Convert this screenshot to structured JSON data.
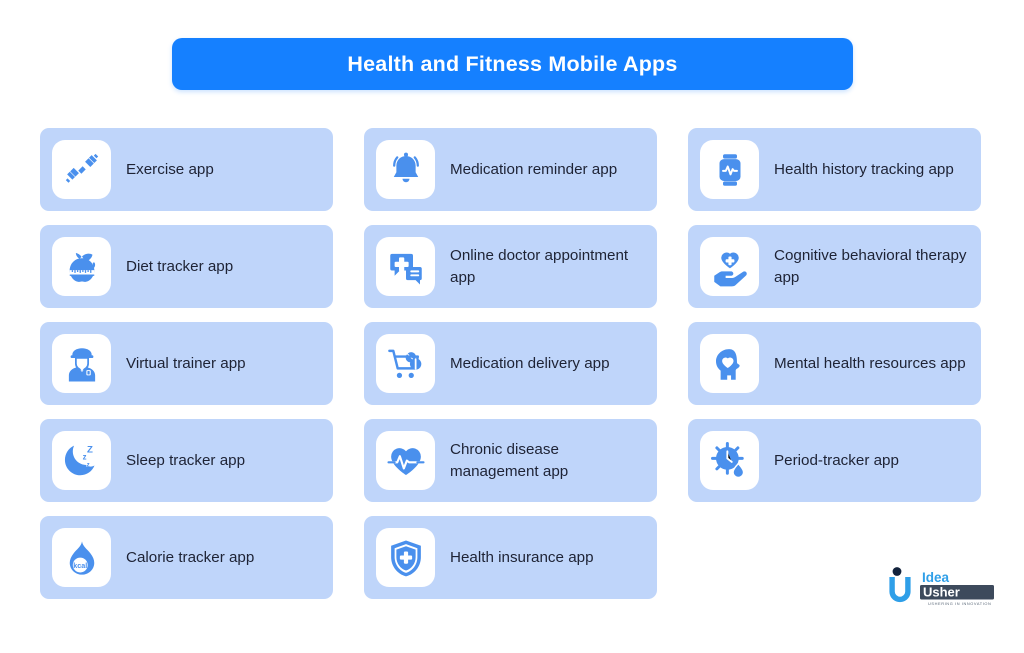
{
  "header": {
    "title": "Health and Fitness Mobile Apps"
  },
  "colors": {
    "banner_blue": "#1580ff",
    "card_blue": "#bfd5fa",
    "icon_blue": "#4a90ed",
    "tile_white": "#ffffff",
    "text_dark": "#1e2335",
    "page_background": "#ffffff"
  },
  "cards": [
    {
      "label": "Exercise app",
      "icon": "dumbbell-icon",
      "column": 1,
      "row": 1
    },
    {
      "label": "Diet tracker app",
      "icon": "apple-measuring-tape-icon",
      "column": 1,
      "row": 2
    },
    {
      "label": "Virtual trainer app",
      "icon": "trainer-person-icon",
      "column": 1,
      "row": 3
    },
    {
      "label": "Sleep tracker app",
      "icon": "moon-zzz-icon",
      "column": 1,
      "row": 4
    },
    {
      "label": "Calorie tracker app",
      "icon": "flame-kcal-icon",
      "column": 1,
      "row": 5
    },
    {
      "label": "Medication reminder app",
      "icon": "ringing-bell-icon",
      "column": 2,
      "row": 1
    },
    {
      "label": "Online doctor appointment app",
      "icon": "chat-medical-cross-icon",
      "column": 2,
      "row": 2
    },
    {
      "label": "Medication delivery app",
      "icon": "cart-pills-icon",
      "column": 2,
      "row": 3
    },
    {
      "label": "Chronic disease management app",
      "icon": "heart-pulse-icon",
      "column": 2,
      "row": 4
    },
    {
      "label": "Health insurance app",
      "icon": "shield-cross-icon",
      "column": 2,
      "row": 5
    },
    {
      "label": "Health history tracking app",
      "icon": "smartwatch-pulse-icon",
      "column": 3,
      "row": 1
    },
    {
      "label": "Cognitive behavioral therapy app",
      "icon": "hand-heart-plus-icon",
      "column": 3,
      "row": 2
    },
    {
      "label": "Mental health resources app",
      "icon": "head-heart-icon",
      "column": 3,
      "row": 3
    },
    {
      "label": "Period-tracker app",
      "icon": "cycle-clock-drop-icon",
      "column": 3,
      "row": 4
    }
  ],
  "icon_labels": {
    "flame_kcal_text": "kcal",
    "moon_zzz_text": "Z"
  },
  "logo": {
    "name_line1": "Idea",
    "name_line2": "Usher",
    "tagline": "USHERING IN INNOVATION"
  }
}
